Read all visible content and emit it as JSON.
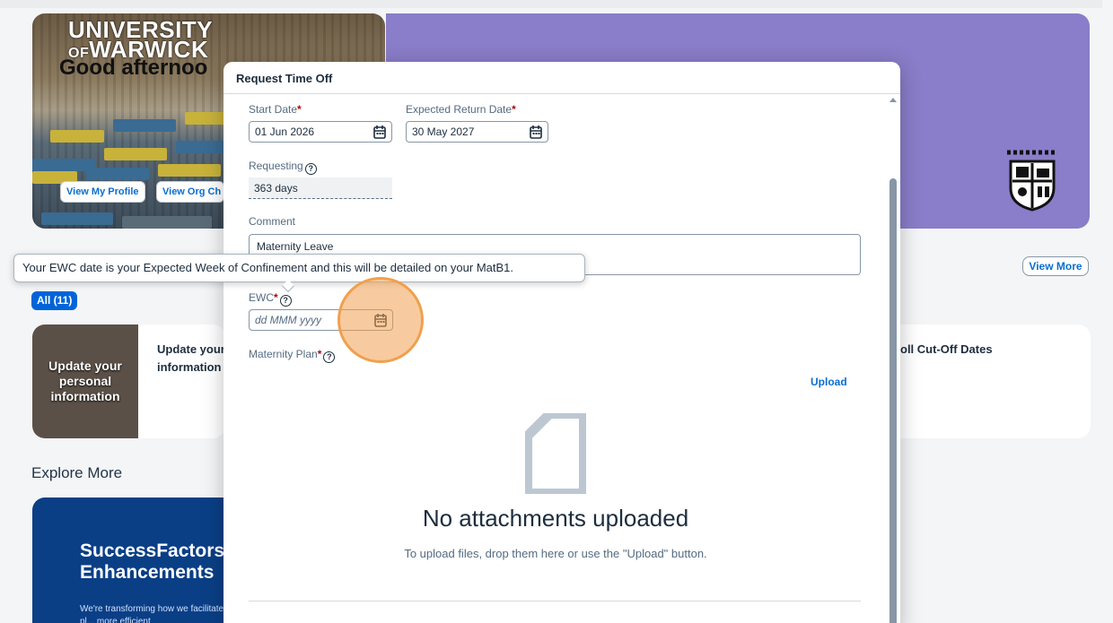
{
  "hero": {
    "logo_line1": "UNIVERSITY",
    "logo_of": "OF",
    "logo_line2": "WARWICK",
    "greeting": "Good afternoo",
    "view_profile": "View My Profile",
    "view_org_chart": "View Org Ch"
  },
  "section": {
    "view_more": "View More",
    "filter_all": "All (11)"
  },
  "cards": [
    {
      "thumb_title": "Update your personal information",
      "heading": "Update your information"
    },
    {
      "heading": "oll Cut-Off Dates"
    }
  ],
  "explore": {
    "title": "Explore More",
    "promo_title": "SuccessFactors Enhancements",
    "promo_body": "We're transforming how we facilitate staff pl... more efficient"
  },
  "dialog": {
    "title": "Request Time Off",
    "start_date_label": "Start Date",
    "start_date_value": "01 Jun 2026",
    "return_date_label": "Expected Return Date",
    "return_date_value": "30 May 2027",
    "requesting_label": "Requesting",
    "requesting_value": "363 days",
    "comment_label": "Comment",
    "comment_value": "Maternity Leave",
    "ewc_label": "EWC",
    "ewc_placeholder": "dd MMM yyyy",
    "plan_label": "Maternity Plan",
    "upload_label": "Upload",
    "empty_title": "No attachments uploaded",
    "empty_subtitle": "To upload files, drop them here or use the \"Upload\" button.",
    "required_marker": "*",
    "help_glyph": "?"
  },
  "tooltip": {
    "text": "Your EWC date is your Expected Week of Confinement and this will be detailed on your MatB1."
  },
  "colors": {
    "brand_purple": "#8a7dc9",
    "link_blue": "#0a6ed1",
    "required_red": "#aa0808",
    "highlight_orange": "#f0a04e"
  }
}
